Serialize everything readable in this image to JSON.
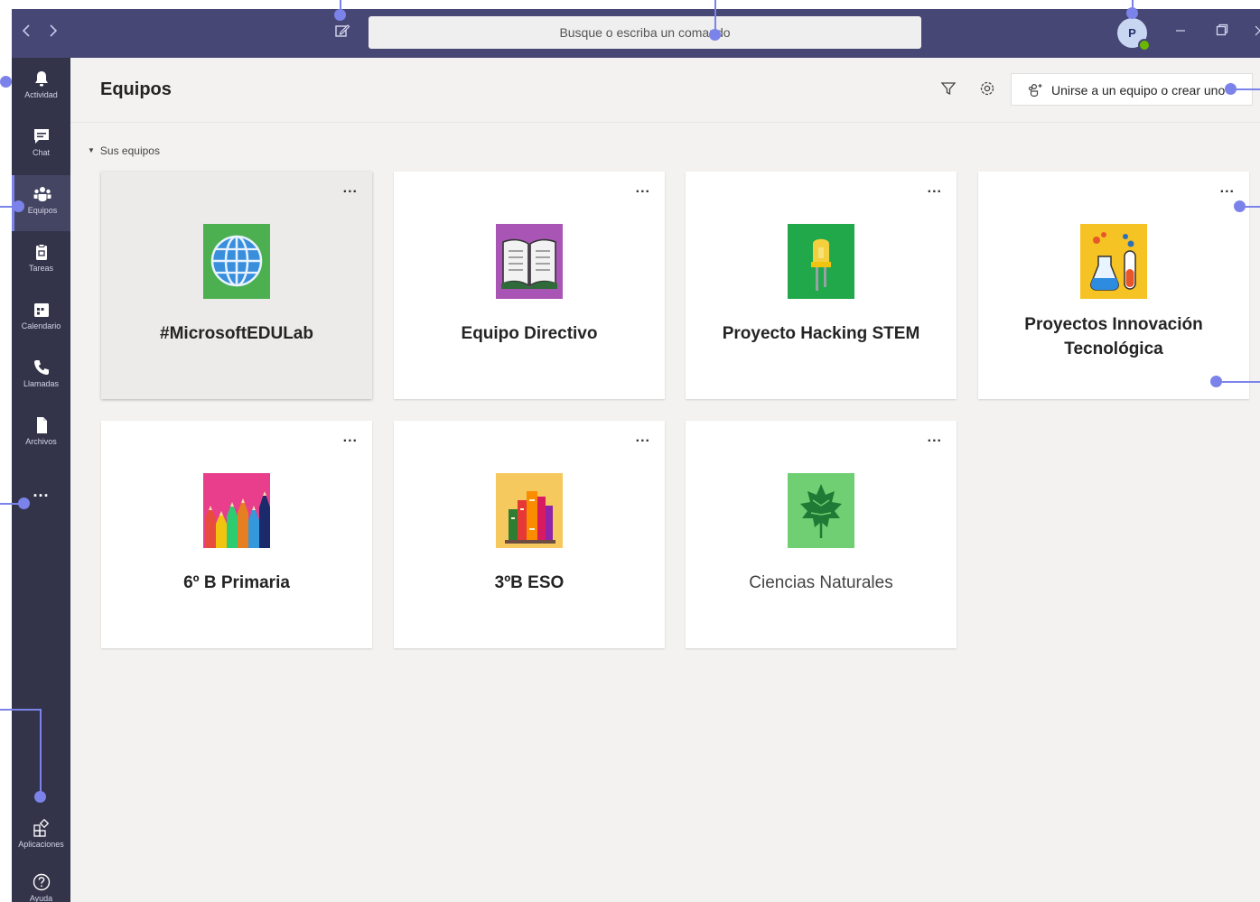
{
  "colors": {
    "titlebar": "#464775",
    "rail": "#33344a",
    "accent": "#7b83eb",
    "content_bg": "#f3f2f1"
  },
  "titlebar": {
    "back_icon": "chevron-left-icon",
    "forward_icon": "chevron-right-icon",
    "search_placeholder": "Busque o escriba un comando",
    "avatar_initial": "P"
  },
  "rail": {
    "items": [
      {
        "label": "Actividad",
        "icon": "bell-icon"
      },
      {
        "label": "Chat",
        "icon": "chat-icon"
      },
      {
        "label": "Equipos",
        "icon": "teams-icon",
        "active": true
      },
      {
        "label": "Tareas",
        "icon": "assignments-icon"
      },
      {
        "label": "Calendario",
        "icon": "calendar-icon"
      },
      {
        "label": "Llamadas",
        "icon": "phone-icon"
      },
      {
        "label": "Archivos",
        "icon": "file-icon"
      }
    ],
    "more": "...",
    "apps_label": "Aplicaciones",
    "help_label": "Ayuda"
  },
  "header": {
    "title": "Equipos",
    "join_label": "Unirse a un equipo o crear uno"
  },
  "section": {
    "label": "Sus equipos"
  },
  "teams": [
    {
      "name": "#MicrosoftEDULab",
      "tile": "globe",
      "selected": true
    },
    {
      "name": "Equipo Directivo",
      "tile": "book"
    },
    {
      "name": "Proyecto Hacking STEM",
      "tile": "led"
    },
    {
      "name": "Proyectos Innovación Tecnológica",
      "tile": "lab"
    },
    {
      "name": "6º B Primaria",
      "tile": "pencils"
    },
    {
      "name": "3ºB ESO",
      "tile": "books"
    },
    {
      "name": "Ciencias Naturales",
      "tile": "leaf"
    }
  ],
  "card_more": "..."
}
